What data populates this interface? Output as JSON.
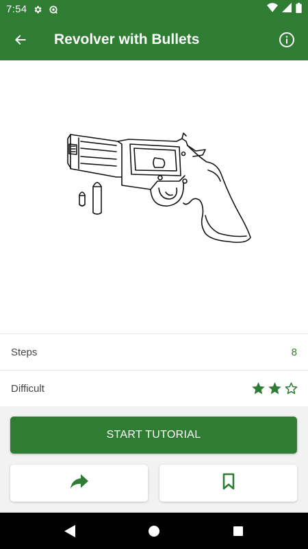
{
  "status_bar": {
    "time": "7:54",
    "icons": [
      "gear-icon",
      "sync-icon",
      "wifi-icon",
      "signal-icon",
      "battery-icon"
    ]
  },
  "app_bar": {
    "title": "Revolver with Bullets",
    "icons": [
      "arrow-back-icon",
      "info-icon"
    ]
  },
  "details": {
    "steps_label": "Steps",
    "steps_value": "8",
    "difficult_label": "Difficult",
    "difficulty_rating": 2,
    "difficulty_max": 3
  },
  "actions": {
    "start_label": "START TUTORIAL",
    "icons": [
      "share-icon",
      "bookmark-icon"
    ]
  },
  "nav_bar": {
    "icons": [
      "back-triangle-icon",
      "home-circle-icon",
      "recents-square-icon"
    ]
  },
  "colors": {
    "primary": "#2e7d32",
    "background": "#f2f2f2",
    "surface": "#ffffff"
  }
}
